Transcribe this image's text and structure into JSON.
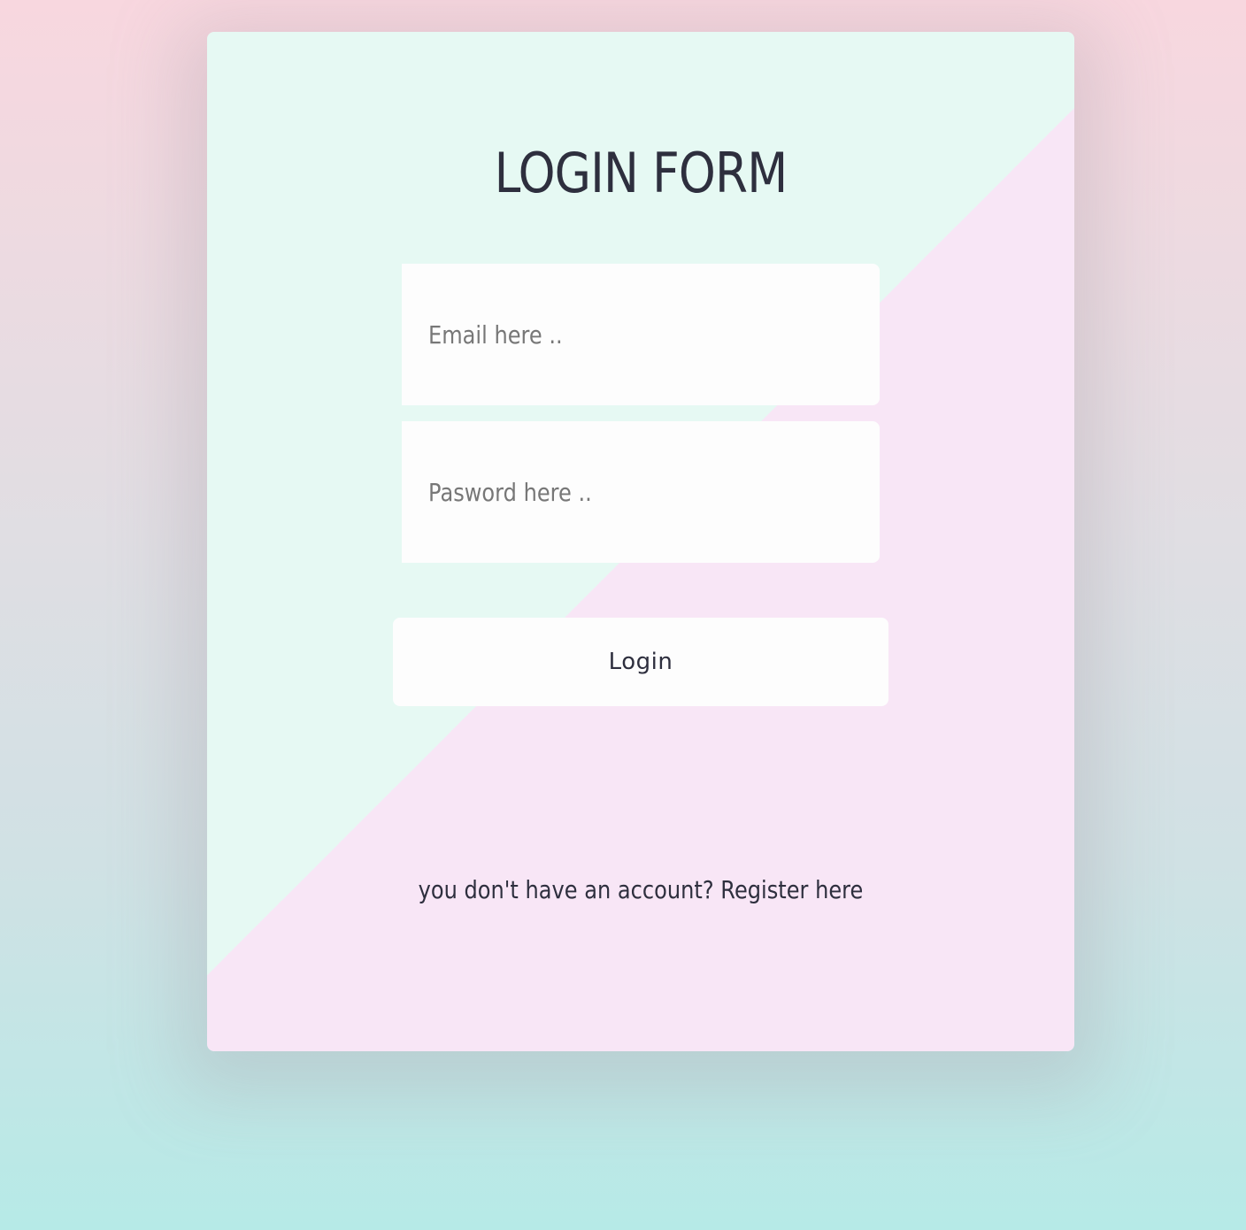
{
  "form": {
    "title": "LOGIN FORM",
    "email_placeholder": "Email here ..",
    "password_placeholder": "Pasword here ..",
    "login_label": "Login",
    "register_prompt": "you don't have an account?",
    "register_link": "Register here"
  },
  "colors": {
    "background_top": "#f8d7df",
    "background_bottom": "#b6eae7",
    "card_mint": "#e6f9f3",
    "card_pink": "#f8e6f6",
    "text": "#2e2f3e",
    "placeholder": "#777777"
  }
}
